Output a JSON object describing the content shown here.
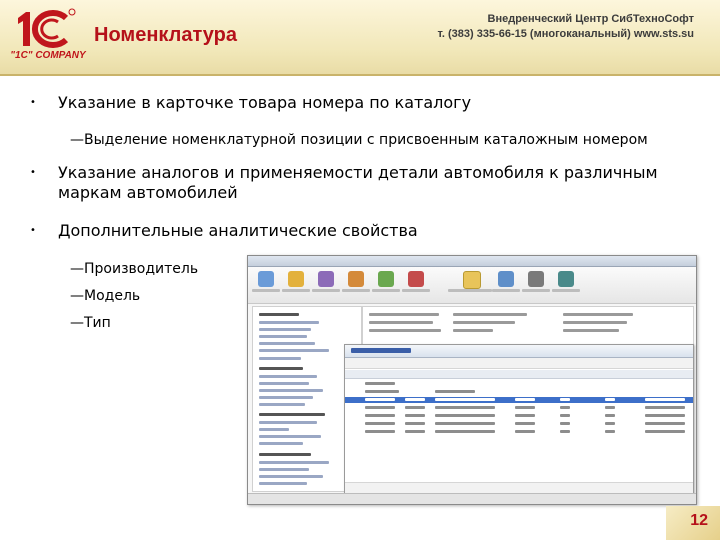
{
  "header": {
    "logo_company": "\"1С\" COMPANY",
    "title": "Номенклатура",
    "org_name": "Внедренческий Центр СибТехноСофт",
    "org_contacts": "т. (383) 335-66-15 (многоканальный) www.sts.su"
  },
  "bullets": [
    {
      "marker": "•",
      "text": "Указание в карточке товара номера по каталогу"
    },
    {
      "marker": "•",
      "text": "Указание аналогов и применяемости детали автомобиля к различным"
    },
    {
      "marker": "•",
      "text": "маркам автомобилей"
    },
    {
      "marker": "•",
      "text": "Дополнительные аналитические свойства"
    }
  ],
  "subitems": [
    "—Выделение номенклатурной позиции с присвоенным каталожным номером",
    "—Производитель",
    "—Модель",
    "—Тип"
  ],
  "page_number": "12",
  "colors": {
    "accent": "#b5111a",
    "header_bg": "#f1e7b8",
    "selection": "#3d6fc9"
  }
}
